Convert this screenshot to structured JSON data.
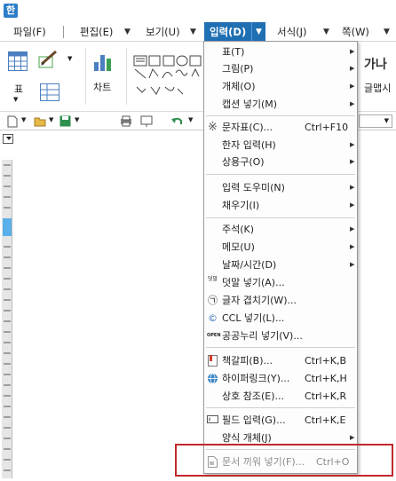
{
  "menubar": {
    "items": [
      {
        "label": "파일(F)"
      },
      {
        "label": "편집(E)"
      },
      {
        "label": "보기(U)"
      },
      {
        "label": "입력(D)"
      },
      {
        "label": "서식(J)"
      },
      {
        "label": "쪽(W)"
      }
    ]
  },
  "ribbon": {
    "table_label": "표",
    "chart_label": "차트",
    "textart_label": "가나",
    "textart_sub": "글맵시"
  },
  "dropdown": {
    "items": [
      {
        "label": "표(T)",
        "submenu": true
      },
      {
        "label": "그림(P)",
        "submenu": true
      },
      {
        "label": "개체(O)",
        "submenu": true
      },
      {
        "label": "캡션 넣기(M)",
        "submenu": true
      },
      {
        "label": "문자표(C)...",
        "shortcut": "Ctrl+F10",
        "icon": "※"
      },
      {
        "label": "한자 입력(H)",
        "submenu": true
      },
      {
        "label": "상용구(O)",
        "submenu": true
      },
      {
        "label": "입력 도우미(N)",
        "submenu": true
      },
      {
        "label": "채우기(I)",
        "submenu": true
      },
      {
        "label": "주석(K)",
        "submenu": true
      },
      {
        "label": "메모(U)",
        "submenu": true
      },
      {
        "label": "날짜/시간(D)",
        "submenu": true
      },
      {
        "label": "덧말 넣기(A)...",
        "icon": "덧말"
      },
      {
        "label": "글자 겹치기(W)...",
        "icon": "㉠"
      },
      {
        "label": "CCL 넣기(L)...",
        "icon": "©"
      },
      {
        "label": "공공누리 넣기(V)...",
        "icon": "OPEN"
      },
      {
        "label": "책갈피(B)...",
        "shortcut": "Ctrl+K,B"
      },
      {
        "label": "하이퍼링크(Y)...",
        "shortcut": "Ctrl+K,H"
      },
      {
        "label": "상호 참조(E)...",
        "shortcut": "Ctrl+K,R"
      },
      {
        "label": "필드 입력(G)...",
        "shortcut": "Ctrl+K,E"
      },
      {
        "label": "양식 개체(J)",
        "submenu": true
      },
      {
        "label": "문서 끼워 넣기(F)...",
        "shortcut": "Ctrl+O"
      }
    ]
  },
  "colors": {
    "menu_active": "#1f6fb3",
    "highlight_box": "#c0282c"
  }
}
